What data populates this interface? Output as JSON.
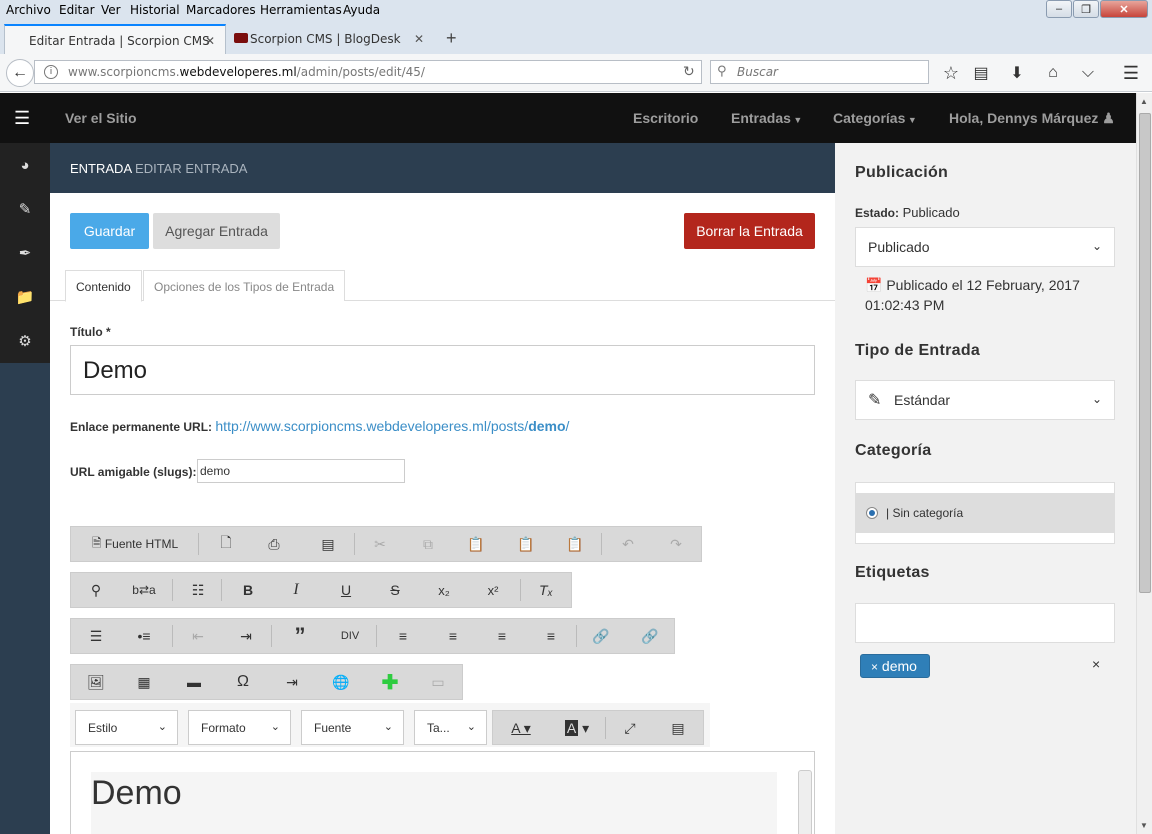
{
  "browser": {
    "menu": [
      "Archivo",
      "Editar",
      "Ver",
      "Historial",
      "Marcadores",
      "Herramientas",
      "Ayuda"
    ],
    "tabs": [
      {
        "label": "Editar Entrada | Scorpion CMS",
        "active": true
      },
      {
        "label": "Scorpion CMS | BlogDesk",
        "active": false
      }
    ],
    "new_tab": "+",
    "url_prefix": "www.scorpioncms.",
    "url_domain": "webdeveloperes.ml",
    "url_path": "/admin/posts/edit/45/",
    "search_placeholder": "Buscar"
  },
  "topnav": {
    "site_link": "Ver el Sitio",
    "items": [
      "Escritorio",
      "Entradas",
      "Categorías",
      "Hola, Dennys Márquez"
    ]
  },
  "header": {
    "section": "ENTRADA",
    "sub": "EDITAR ENTRADA"
  },
  "actions": {
    "save": "Guardar",
    "add": "Agregar Entrada",
    "delete": "Borrar la Entrada"
  },
  "content_tabs": [
    "Contenido",
    "Opciones de los Tipos de Entrada"
  ],
  "form": {
    "title_label": "Título *",
    "title_value": "Demo",
    "permalink_label": "Enlace permanente URL:",
    "permalink_base": "http://www.scorpioncms.webdeveloperes.ml/posts/",
    "permalink_slug": "demo",
    "permalink_end": "/",
    "slug_label": "URL amigable (slugs):",
    "slug_value": "demo"
  },
  "editor": {
    "source_label": "Fuente HTML",
    "combos": [
      "Estilo",
      "Formato",
      "Fuente",
      "Ta..."
    ],
    "content_heading": "Demo"
  },
  "sidebar": {
    "publication_title": "Publicación",
    "status_label": "Estado:",
    "status_value": "Publicado",
    "status_select": "Publicado",
    "published_on": "Publicado el 12 February, 2017",
    "published_time": "01:02:43 PM",
    "type_title": "Tipo de Entrada",
    "type_select": "Estándar",
    "category_title": "Categoría",
    "category_item": "| Sin categoría",
    "tags_title": "Etiquetas",
    "tag": "demo",
    "tag_remove": "×",
    "tags_clear": "×"
  }
}
